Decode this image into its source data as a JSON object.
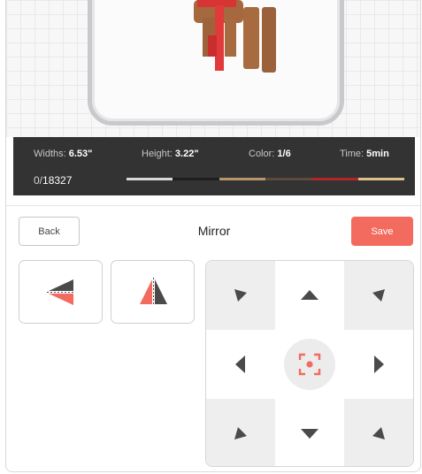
{
  "info_bar": {
    "width_label": "Widths:",
    "width_value": "6.53\"",
    "height_label": "Height:",
    "height_value": "3.22\"",
    "color_label": "Color:",
    "color_value": "1/6",
    "time_label": "Time:",
    "time_value": "5min",
    "stitch_start": "0/",
    "stitch_total": "18327"
  },
  "color_strip": [
    "#d8d8d8",
    "#1e1e1e",
    "#b8956b",
    "#5e4a3a",
    "#b0272a",
    "#e0c08a"
  ],
  "toolbar": {
    "back_label": "Back",
    "title": "Mirror",
    "save_label": "Save"
  },
  "colors": {
    "accent": "#f36a5e",
    "dark": "#4a4a4a"
  }
}
